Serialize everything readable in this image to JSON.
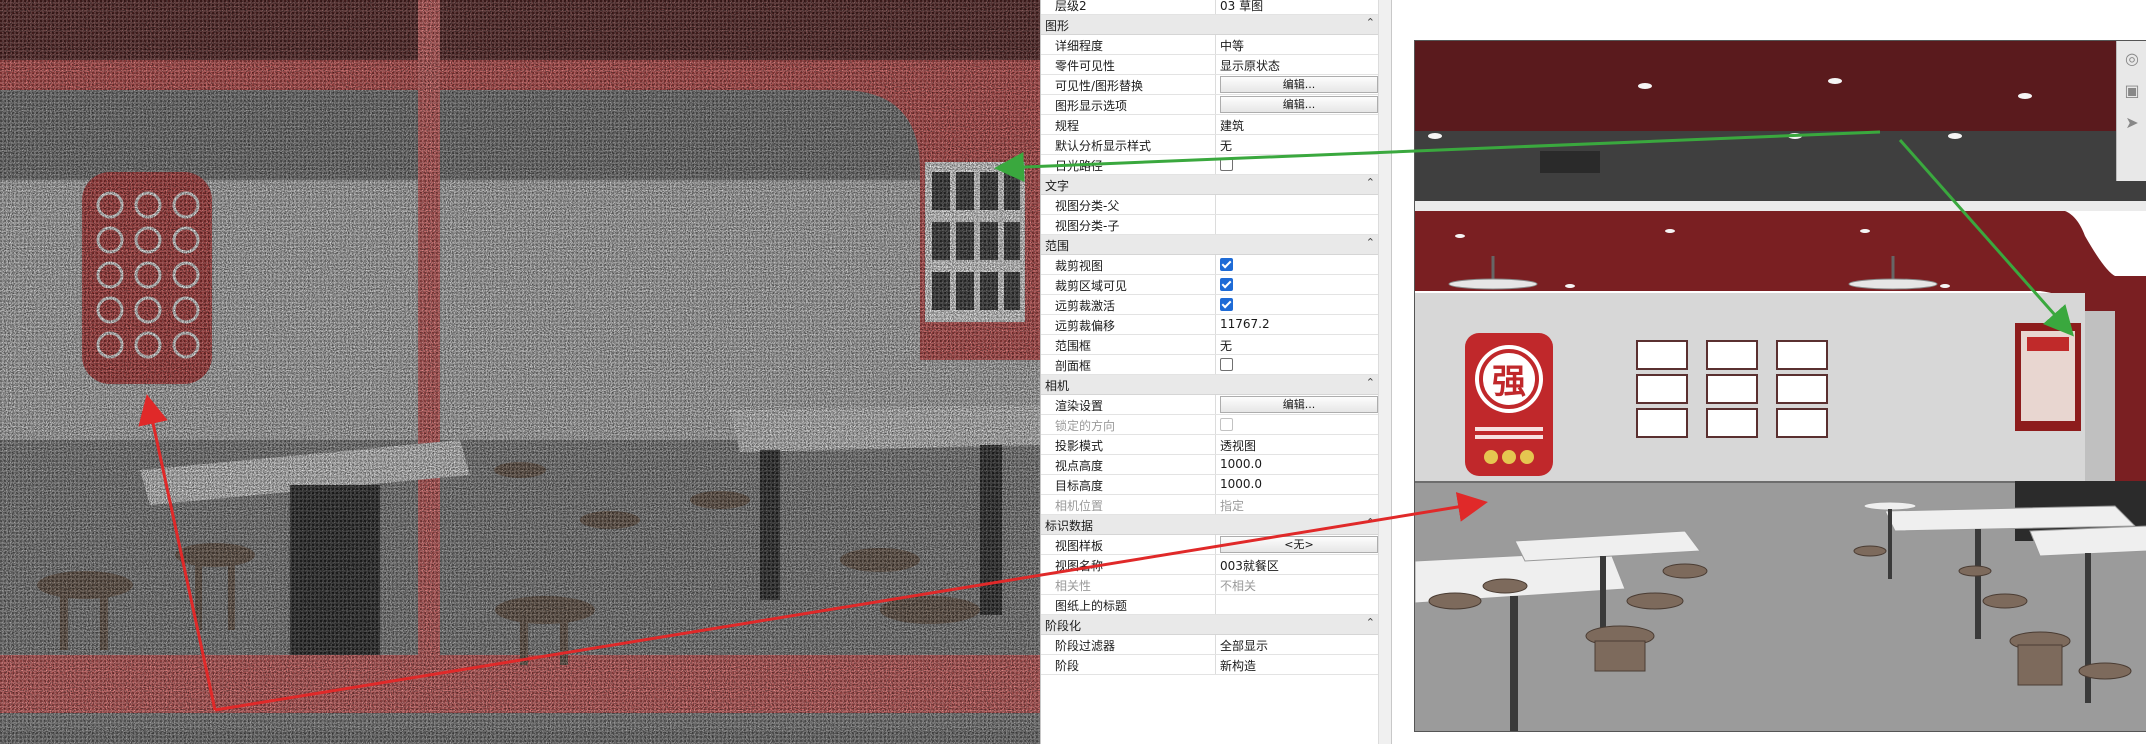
{
  "properties": {
    "top_rows": [
      {
        "label": "层级2",
        "value": "03 草图"
      }
    ],
    "sections": [
      {
        "title": "图形",
        "rows": [
          {
            "label": "详细程度",
            "type": "text",
            "value": "中等"
          },
          {
            "label": "零件可见性",
            "type": "text",
            "value": "显示原状态"
          },
          {
            "label": "可见性/图形替换",
            "type": "button",
            "value": "编辑..."
          },
          {
            "label": "图形显示选项",
            "type": "button",
            "value": "编辑..."
          },
          {
            "label": "规程",
            "type": "text",
            "value": "建筑"
          },
          {
            "label": "默认分析显示样式",
            "type": "text",
            "value": "无"
          },
          {
            "label": "日光路径",
            "type": "checkbox",
            "checked": false
          }
        ]
      },
      {
        "title": "文字",
        "rows": [
          {
            "label": "视图分类-父",
            "type": "text",
            "value": ""
          },
          {
            "label": "视图分类-子",
            "type": "text",
            "value": ""
          }
        ]
      },
      {
        "title": "范围",
        "rows": [
          {
            "label": "裁剪视图",
            "type": "checkbox",
            "checked": true
          },
          {
            "label": "裁剪区域可见",
            "type": "checkbox",
            "checked": true
          },
          {
            "label": "远剪裁激活",
            "type": "checkbox",
            "checked": true
          },
          {
            "label": "远剪裁偏移",
            "type": "text",
            "value": "11767.2"
          },
          {
            "label": "范围框",
            "type": "text",
            "value": "无"
          },
          {
            "label": "剖面框",
            "type": "checkbox",
            "checked": false
          }
        ]
      },
      {
        "title": "相机",
        "rows": [
          {
            "label": "渲染设置",
            "type": "button",
            "value": "编辑..."
          },
          {
            "label": "锁定的方向",
            "type": "checkbox",
            "checked": false,
            "disabled": true
          },
          {
            "label": "投影模式",
            "type": "text",
            "value": "透视图"
          },
          {
            "label": "视点高度",
            "type": "text",
            "value": "1000.0"
          },
          {
            "label": "目标高度",
            "type": "text",
            "value": "1000.0"
          },
          {
            "label": "相机位置",
            "type": "text",
            "value": "指定",
            "disabled": true
          }
        ]
      },
      {
        "title": "标识数据",
        "rows": [
          {
            "label": "视图样板",
            "type": "button",
            "value": "<无>"
          },
          {
            "label": "视图名称",
            "type": "text",
            "value": "003就餐区"
          },
          {
            "label": "相关性",
            "type": "text",
            "value": "不相关",
            "disabled": true
          },
          {
            "label": "图纸上的标题",
            "type": "text",
            "value": ""
          }
        ]
      },
      {
        "title": "阶段化",
        "rows": [
          {
            "label": "阶段过滤器",
            "type": "text",
            "value": "全部显示"
          },
          {
            "label": "阶段",
            "type": "text",
            "value": "新构造"
          }
        ]
      }
    ]
  },
  "viewport": {
    "wall_panel_glyph": "强",
    "wall_panel_caption": "",
    "nav_icons": [
      "steering-wheel-icon",
      "zoom-region-icon",
      "fly-icon"
    ]
  },
  "colors": {
    "red_highlight": "#e0504f",
    "dark_red_ceiling": "#7a1f22",
    "green_arrow": "#3aa83e",
    "red_arrow": "#e02929",
    "checkbox_blue": "#1e6bd6"
  }
}
